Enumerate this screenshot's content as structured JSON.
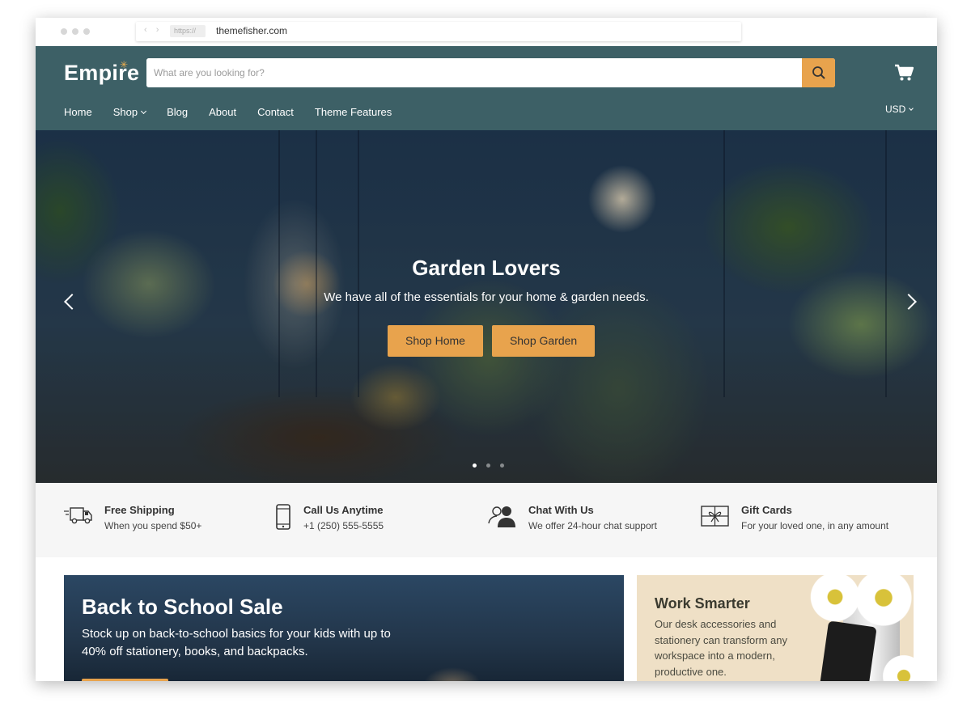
{
  "browser": {
    "url_protocol": "https://",
    "url_host": "themefisher.com",
    "nav_arrows": "‹ ›"
  },
  "header": {
    "logo": "Empire",
    "search_placeholder": "What are you looking for?",
    "currency": "USD",
    "nav": [
      {
        "label": "Home"
      },
      {
        "label": "Shop"
      },
      {
        "label": "Blog"
      },
      {
        "label": "About"
      },
      {
        "label": "Contact"
      },
      {
        "label": "Theme Features"
      }
    ],
    "colors": {
      "background": "#3d6066",
      "accent": "#e8a34d"
    }
  },
  "hero": {
    "title": "Garden Lovers",
    "subtitle": "We have all of the essentials for your home & garden needs.",
    "buttons": [
      "Shop Home",
      "Shop Garden"
    ],
    "slide_count": 3,
    "active_slide": 1
  },
  "features": [
    {
      "icon": "truck-icon",
      "title": "Free Shipping",
      "subtitle": "When you spend $50+"
    },
    {
      "icon": "phone-icon",
      "title": "Call Us Anytime",
      "subtitle": "+1 (250) 555-5555"
    },
    {
      "icon": "chat-users-icon",
      "title": "Chat With Us",
      "subtitle": "We offer 24-hour chat support"
    },
    {
      "icon": "gift-icon",
      "title": "Gift Cards",
      "subtitle": "For your loved one, in any amount"
    }
  ],
  "promos": {
    "left": {
      "title": "Back to School Sale",
      "text": "Stock up on back-to-school basics for your kids with up to 40% off stationery, books, and backpacks."
    },
    "right": {
      "title": "Work Smarter",
      "text": "Our desk accessories and stationery can transform any workspace into a modern, productive one."
    }
  }
}
